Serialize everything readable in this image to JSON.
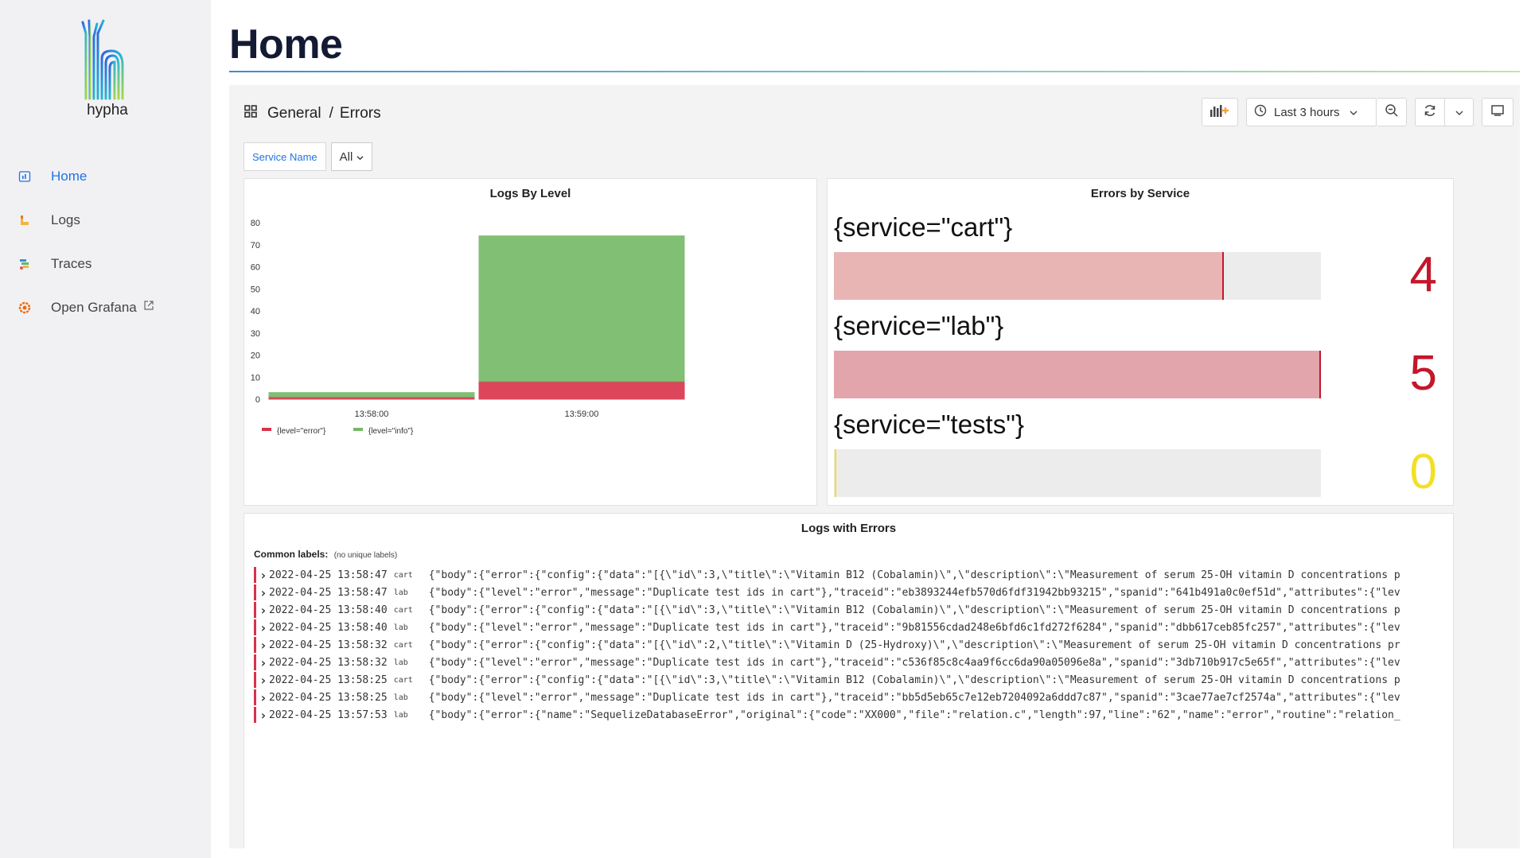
{
  "app": {
    "logo_text": "hypha",
    "page_title": "Home"
  },
  "sidebar": {
    "items": [
      {
        "label": "Home",
        "icon": "dashboard-icon",
        "active": true
      },
      {
        "label": "Logs",
        "icon": "logs-icon",
        "active": false
      },
      {
        "label": "Traces",
        "icon": "traces-icon",
        "active": false
      },
      {
        "label": "Open Grafana",
        "icon": "grafana-icon",
        "active": false,
        "external": true
      }
    ]
  },
  "breadcrumb": {
    "folder": "General",
    "separator": "/",
    "dashboard": "Errors"
  },
  "toolbar": {
    "add_panel_icon": "add-panel-icon",
    "time_range": "Last 3 hours",
    "zoom_icon": "zoom-out-icon",
    "refresh_icon": "refresh-icon",
    "tv_icon": "tv-mode-icon"
  },
  "filters": {
    "service_label": "Service Name",
    "service_value": "All"
  },
  "colors": {
    "accent": "#1f73e6",
    "error": "#d8324a",
    "info": "#73b965",
    "gauge_red": "#c4162a",
    "gauge_yellow": "#f2e027"
  },
  "logs_by_level": {
    "title": "Logs By Level",
    "chart_data": {
      "type": "bar",
      "stacked": true,
      "categories": [
        "13:58:00",
        "13:59:00"
      ],
      "series": [
        {
          "name": "{level=\"error\"}",
          "values": [
            1,
            8
          ],
          "color": "#d8324a"
        },
        {
          "name": "{level=\"info\"}",
          "values": [
            2,
            66
          ],
          "color": "#73b965"
        }
      ],
      "ylim": [
        0,
        80
      ],
      "yticks": [
        0,
        10,
        20,
        30,
        40,
        50,
        60,
        70,
        80
      ],
      "legend": "bottom-left",
      "grid": false
    }
  },
  "errors_by_service": {
    "title": "Errors by Service",
    "max": 5,
    "rows": [
      {
        "label": "{service=\"cart\"}",
        "value": 4,
        "display": "4",
        "fill": "#e8b4b4",
        "edge": "#c4162a",
        "text_color": "#c4162a"
      },
      {
        "label": "{service=\"lab\"}",
        "value": 5,
        "display": "5",
        "fill": "#e3a5ac",
        "edge": "#c4162a",
        "text_color": "#c4162a"
      },
      {
        "label": "{service=\"tests\"}",
        "value": 0,
        "display": "0",
        "fill": "#f2e027",
        "edge": "#f2e027",
        "text_color": "#f2e027"
      }
    ]
  },
  "logs_with_errors": {
    "title": "Logs with Errors",
    "common_label": "Common labels:",
    "common_value": "(no unique labels)",
    "rows": [
      {
        "ts": "2022-04-25 13:58:47",
        "svc": "cart",
        "body": "{\"body\":{\"error\":{\"config\":{\"data\":\"[{\\\"id\\\":3,\\\"title\\\":\\\"Vitamin B12 (Cobalamin)\\\",\\\"description\\\":\\\"Measurement of serum 25-OH vitamin D concentrations p"
      },
      {
        "ts": "2022-04-25 13:58:47",
        "svc": "lab",
        "body": "{\"body\":{\"level\":\"error\",\"message\":\"Duplicate test ids in cart\"},\"traceid\":\"eb3893244efb570d6fdf31942bb93215\",\"spanid\":\"641b491a0c0ef51d\",\"attributes\":{\"lev"
      },
      {
        "ts": "2022-04-25 13:58:40",
        "svc": "cart",
        "body": "{\"body\":{\"error\":{\"config\":{\"data\":\"[{\\\"id\\\":3,\\\"title\\\":\\\"Vitamin B12 (Cobalamin)\\\",\\\"description\\\":\\\"Measurement of serum 25-OH vitamin D concentrations p"
      },
      {
        "ts": "2022-04-25 13:58:40",
        "svc": "lab",
        "body": "{\"body\":{\"level\":\"error\",\"message\":\"Duplicate test ids in cart\"},\"traceid\":\"9b81556cdad248e6bfd6c1fd272f6284\",\"spanid\":\"dbb617ceb85fc257\",\"attributes\":{\"lev"
      },
      {
        "ts": "2022-04-25 13:58:32",
        "svc": "cart",
        "body": "{\"body\":{\"error\":{\"config\":{\"data\":\"[{\\\"id\\\":2,\\\"title\\\":\\\"Vitamin D (25-Hydroxy)\\\",\\\"description\\\":\\\"Measurement of serum 25-OH vitamin D concentrations pr"
      },
      {
        "ts": "2022-04-25 13:58:32",
        "svc": "lab",
        "body": "{\"body\":{\"level\":\"error\",\"message\":\"Duplicate test ids in cart\"},\"traceid\":\"c536f85c8c4aa9f6cc6da90a05096e8a\",\"spanid\":\"3db710b917c5e65f\",\"attributes\":{\"lev"
      },
      {
        "ts": "2022-04-25 13:58:25",
        "svc": "cart",
        "body": "{\"body\":{\"error\":{\"config\":{\"data\":\"[{\\\"id\\\":3,\\\"title\\\":\\\"Vitamin B12 (Cobalamin)\\\",\\\"description\\\":\\\"Measurement of serum 25-OH vitamin D concentrations p"
      },
      {
        "ts": "2022-04-25 13:58:25",
        "svc": "lab",
        "body": "{\"body\":{\"level\":\"error\",\"message\":\"Duplicate test ids in cart\"},\"traceid\":\"bb5d5eb65c7e12eb7204092a6ddd7c87\",\"spanid\":\"3cae77ae7cf2574a\",\"attributes\":{\"lev"
      },
      {
        "ts": "2022-04-25 13:57:53",
        "svc": "lab",
        "body": "{\"body\":{\"error\":{\"name\":\"SequelizeDatabaseError\",\"original\":{\"code\":\"XX000\",\"file\":\"relation.c\",\"length\":97,\"line\":\"62\",\"name\":\"error\",\"routine\":\"relation_"
      }
    ]
  }
}
